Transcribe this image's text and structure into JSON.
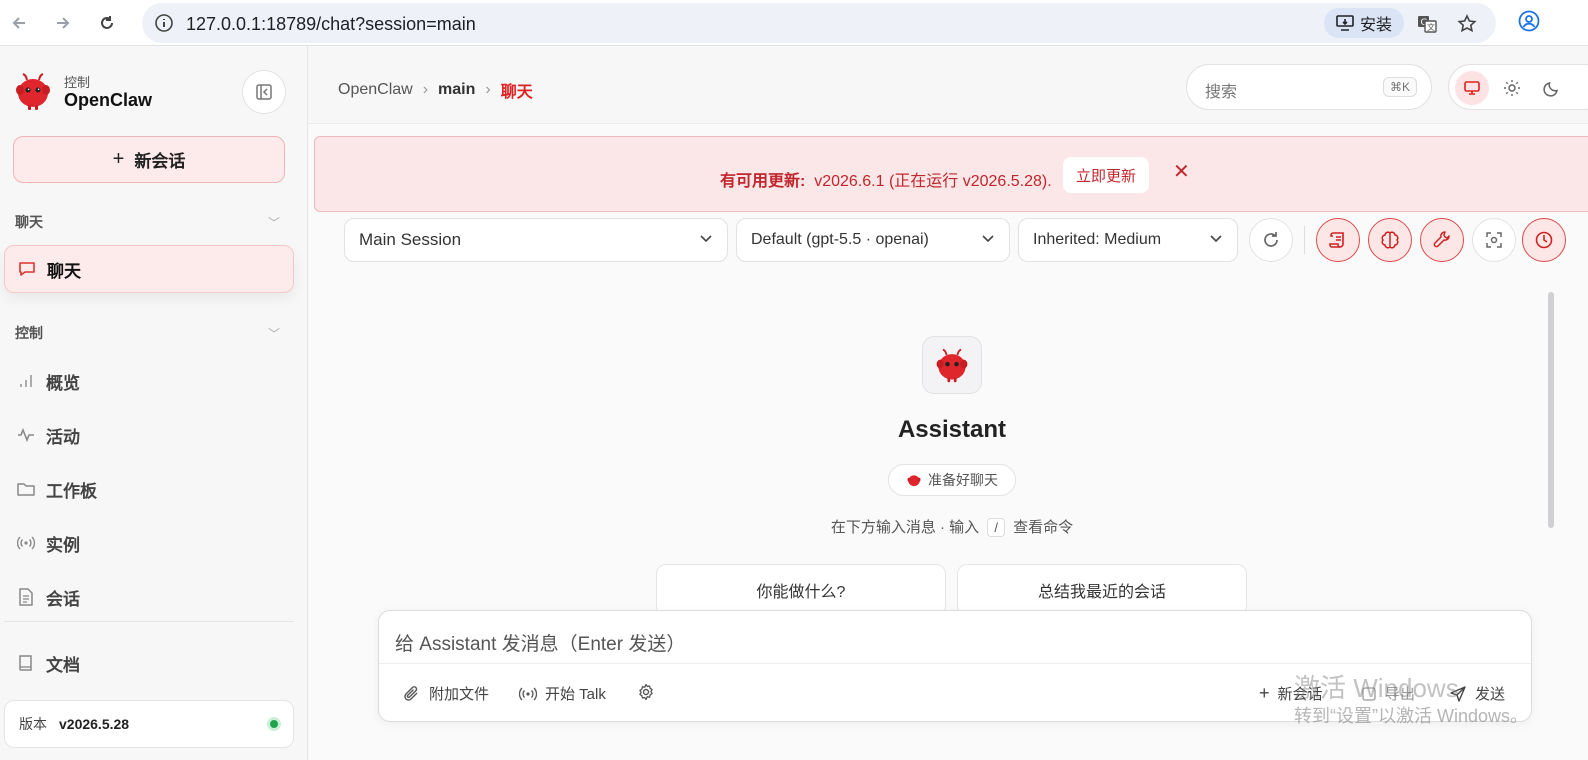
{
  "browser": {
    "url": "127.0.0.1:18789/chat?session=main",
    "install_label": "安装"
  },
  "sidebar": {
    "brand_small": "控制",
    "brand_name": "OpenClaw",
    "new_session_label": "新会话",
    "sections": [
      {
        "label": "聊天"
      },
      {
        "label": "控制"
      }
    ],
    "items": [
      {
        "label": "聊天"
      },
      {
        "label": "概览"
      },
      {
        "label": "活动"
      },
      {
        "label": "工作板"
      },
      {
        "label": "实例"
      },
      {
        "label": "会话"
      },
      {
        "label": "文档"
      }
    ],
    "version_label": "版本",
    "version_value": "v2026.5.28"
  },
  "header": {
    "crumbs": [
      "OpenClaw",
      "main",
      "聊天"
    ],
    "search_placeholder": "搜索",
    "search_shortcut": "⌘K"
  },
  "banner": {
    "title": "有可用更新:",
    "detail": "v2026.6.1 (正在运行 v2026.5.28).",
    "button_label": "立即更新"
  },
  "toolbar": {
    "session_select": "Main Session",
    "model_select": "Default (gpt-5.5 · openai)",
    "thinking_select": "Inherited: Medium"
  },
  "welcome": {
    "name": "Assistant",
    "status": "准备好聊天",
    "hint_before": "在下方输入消息 · 输入",
    "hint_key": "/",
    "hint_after": "查看命令",
    "suggestions": [
      "你能做什么?",
      "总结我最近的会话"
    ]
  },
  "composer": {
    "placeholder": "给 Assistant 发消息（Enter 发送）",
    "attach_label": "附加文件",
    "talk_label": "开始 Talk",
    "new_session_label": "新会话",
    "export_label": "导出",
    "send_label": "发送"
  },
  "watermark": {
    "line1": "激活 Windows",
    "line2": "转到“设置”以激活 Windows。"
  },
  "colors": {
    "accent": "#d22222",
    "accent_bg": "#fde6e6",
    "status_online": "#1fa44a"
  }
}
